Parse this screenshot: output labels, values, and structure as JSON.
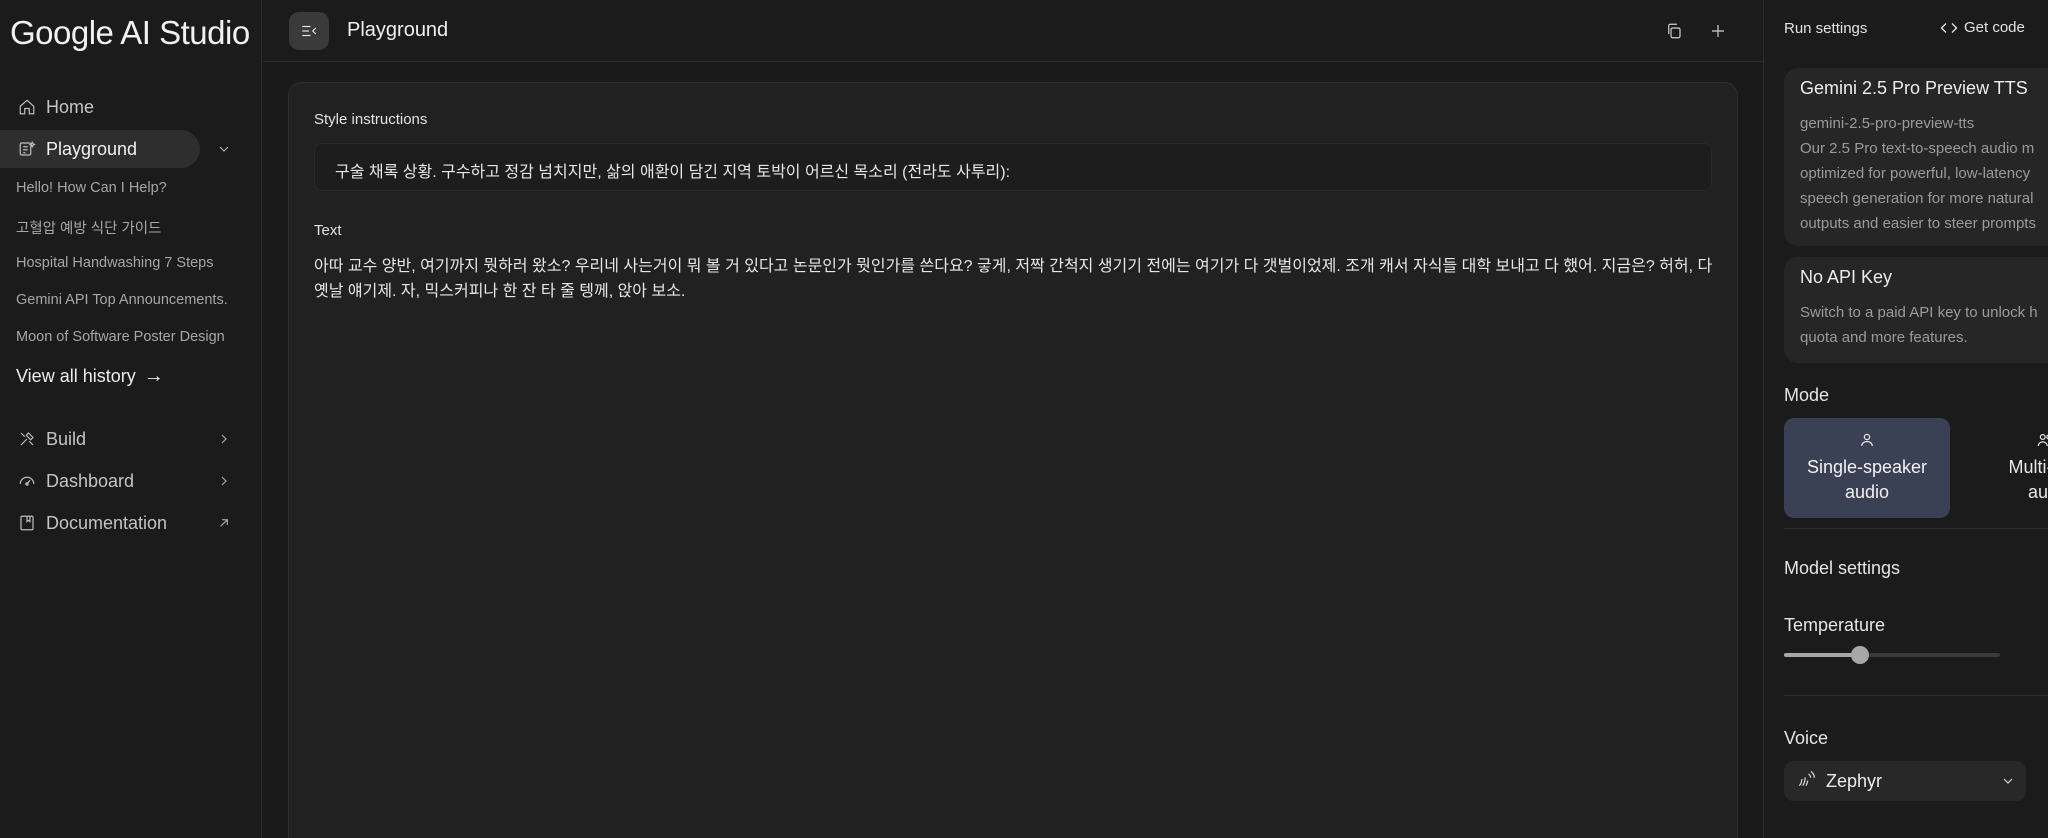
{
  "app": {
    "logo_text": "Google AI Studio"
  },
  "sidebar": {
    "home_label": "Home",
    "playground_label": "Playground",
    "history": [
      "Hello! How Can I Help?",
      "고혈압 예방 식단 가이드",
      "Hospital Handwashing 7 Steps",
      "Gemini API Top Announcements.",
      "Moon of Software Poster Design"
    ],
    "view_all_label": "View all history",
    "view_all_arrow": "→",
    "build_label": "Build",
    "dashboard_label": "Dashboard",
    "documentation_label": "Documentation"
  },
  "header": {
    "title": "Playground"
  },
  "main": {
    "style_label": "Style instructions",
    "style_value": "구술 채록 상황. 구수하고 정감 넘치지만, 삶의 애환이 담긴 지역 토박이 어르신 목소리 (전라도 사투리):",
    "text_label": "Text",
    "text_value": "아따 교수 양반, 여기까지 뭣하러 왔소? 우리네 사는거이 뭐 볼 거 있다고 논문인가 뭣인가를 쓴다요? 긓게, 저짝 간척지 생기기 전에는 여기가 다 갯벌이었제. 조개 캐서 자식들 대학 보내고 다 했어. 지금은? 허허, 다 옛날 얘기제. 자, 믹스커피나 한 잔 타 줄 텡께, 앉아 보소."
  },
  "run_settings": {
    "title": "Run settings",
    "get_code_label": "Get code",
    "model_card": {
      "name": "Gemini 2.5 Pro Preview TTS",
      "id": "gemini-2.5-pro-preview-tts",
      "desc_lines": [
        "Our 2.5 Pro text-to-speech audio m",
        "optimized for powerful, low-latency",
        "speech generation for more natural",
        "outputs and easier to steer prompts"
      ]
    },
    "api_card": {
      "title": "No API Key",
      "desc_lines": [
        "Switch to a paid API key to unlock h",
        "quota and more features."
      ]
    },
    "mode_label": "Mode",
    "mode_single_line1": "Single-speaker",
    "mode_single_line2": "audio",
    "mode_multi_line1": "Multi-spe",
    "mode_multi_line2": "audi",
    "model_settings_label": "Model settings",
    "temperature_label": "Temperature",
    "temperature_fraction": 0.35,
    "voice_label": "Voice",
    "voice_value": "Zephyr"
  },
  "colors": {
    "background": "#1a1a1a",
    "panel": "#212121",
    "mode_selected": "#3b4154"
  }
}
